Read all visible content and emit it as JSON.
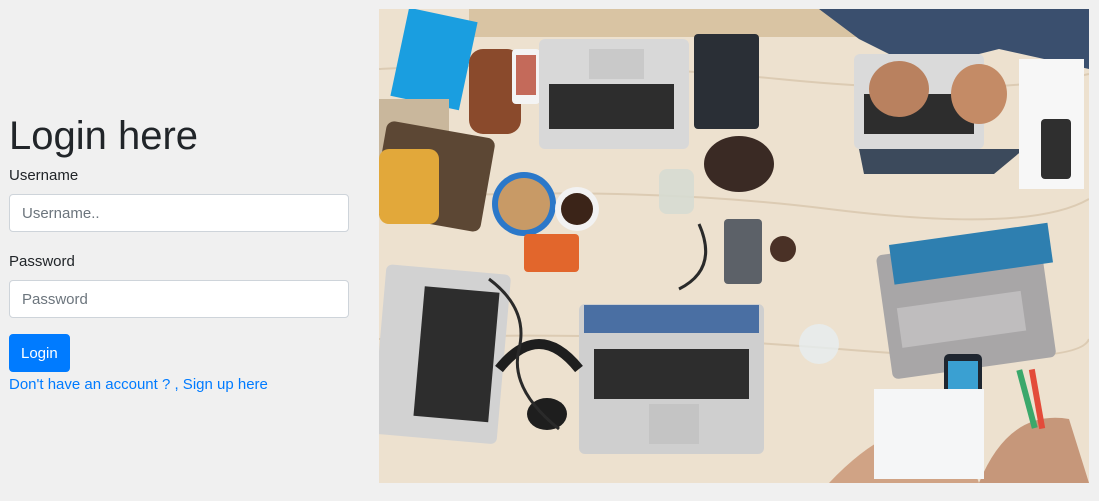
{
  "login": {
    "title": "Login here",
    "username_label": "Username",
    "username_placeholder": "Username..",
    "password_label": "Password",
    "password_placeholder": "Password",
    "login_button": "Login",
    "signup_link": "Don't have an account ? , Sign up here"
  },
  "colors": {
    "background": "#f0f0f0",
    "primary": "#007bff",
    "text": "#212529"
  },
  "image": {
    "subject": "workspace-photo"
  }
}
